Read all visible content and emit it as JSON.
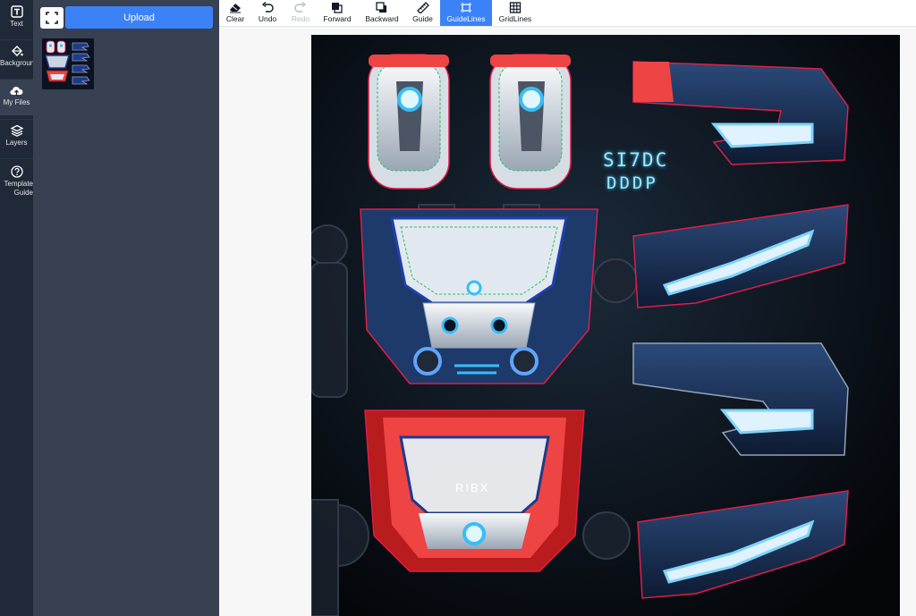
{
  "sidebar": {
    "items": [
      {
        "label": "Text",
        "icon": "text-icon"
      },
      {
        "label": "Background",
        "icon": "paint-bucket-icon"
      },
      {
        "label": "My Files",
        "icon": "cloud-upload-icon",
        "active": true
      },
      {
        "label": "Layers",
        "icon": "layers-icon"
      },
      {
        "label": "Template Guide",
        "icon": "help-circle-icon"
      }
    ]
  },
  "files_panel": {
    "upload_label": "Upload",
    "expand_icon": "expand-icon"
  },
  "toolbar": {
    "tools": [
      {
        "label": "Clear",
        "icon": "eraser-icon"
      },
      {
        "label": "Undo",
        "icon": "undo-icon"
      },
      {
        "label": "Redo",
        "icon": "redo-icon",
        "disabled": true
      },
      {
        "label": "Forward",
        "icon": "bring-forward-icon"
      },
      {
        "label": "Backward",
        "icon": "send-backward-icon"
      },
      {
        "label": "Guide",
        "icon": "ruler-icon"
      },
      {
        "label": "GuideLines",
        "icon": "guidelines-icon",
        "active": true
      },
      {
        "label": "GridLines",
        "icon": "grid-icon"
      }
    ]
  },
  "canvas": {
    "chest_badge": "RIBX",
    "glyph_line1": "SI7DC",
    "glyph_line2": "DDDP"
  },
  "colors": {
    "rail_bg": "#1f2937",
    "panel_bg": "#374151",
    "accent": "#3b82f6",
    "guide_red": "#e11d48",
    "guide_green": "#22c55e",
    "guide_blue": "#2563eb"
  }
}
